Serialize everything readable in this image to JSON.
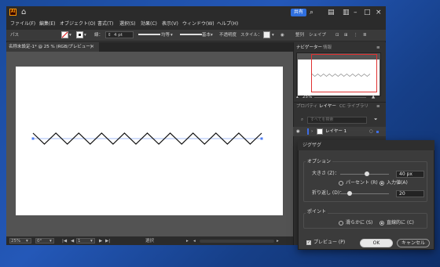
{
  "app": {
    "logo": "Ai",
    "share_label": "共有",
    "menus": [
      "ファイル(F)",
      "編集(E)",
      "オブジェクト(O)",
      "書式(T)",
      "選択(S)",
      "効果(C)",
      "表示(V)",
      "ウィンドウ(W)",
      "ヘルプ(H)"
    ]
  },
  "control_bar": {
    "object_type": "パス",
    "stroke_label": "線：",
    "stroke_weight": "4 pt",
    "profile_label": "均等",
    "brush_label": "基本",
    "opacity_label": "不透明度",
    "style_label": "スタイル：",
    "align_label": "整列",
    "shape_label": "シェイプ"
  },
  "document": {
    "tab_title": "名称未設定-1* @ 25 % (RGB/プレビュー)",
    "close": "×"
  },
  "status_bar": {
    "zoom": "25%",
    "rotation": "0°",
    "artboard_num": "1",
    "tool": "選択"
  },
  "right_panel": {
    "tabs_top": [
      "ナビゲーター",
      "情報"
    ],
    "nav_zoom": "25%",
    "tabs_bottom": [
      "プロパティ",
      "レイヤー",
      "CC ライブラリ"
    ],
    "search_placeholder": "すべてを検索",
    "layer_name": "レイヤー 1"
  },
  "dialog": {
    "title": "ジグザグ",
    "options_label": "オプション",
    "size_label": "大きさ (Z)：",
    "size_value": "40 px",
    "percent_label": "パーセント (R)",
    "absolute_label": "入力値(A)",
    "ridges_label": "折り返し (D)：",
    "ridges_value": "20",
    "points_label": "ポイント",
    "smooth_label": "滑らかに (S)",
    "corner_label": "直線的に (C)",
    "preview_label": "プレビュー (P)",
    "ok_label": "OK",
    "cancel_label": "キャンセル",
    "size_fraction": 0.55,
    "ridges_fraction": 0.2
  }
}
